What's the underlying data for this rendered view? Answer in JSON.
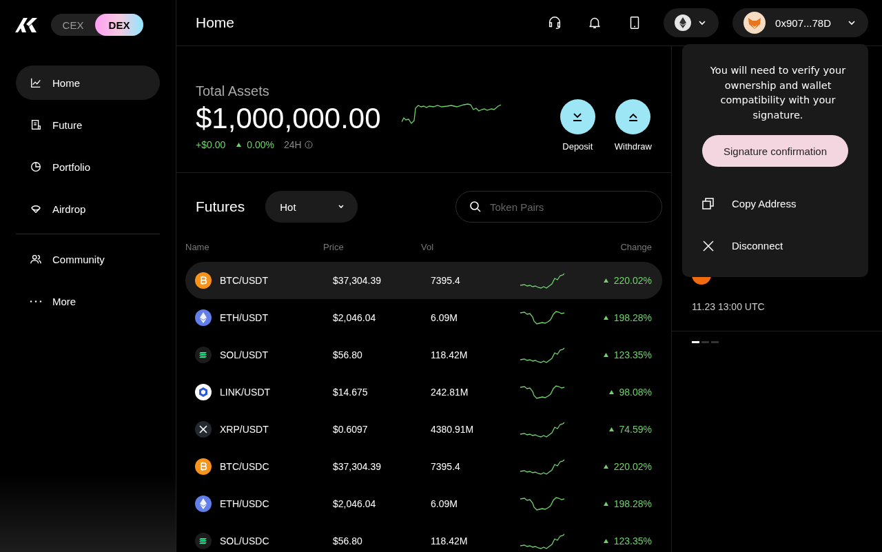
{
  "sidebar": {
    "mode_toggle": [
      {
        "label": "CEX",
        "selected": false
      },
      {
        "label": "DEX",
        "selected": true
      }
    ],
    "items": [
      {
        "kind": "chart",
        "label": "Home",
        "selected": true
      },
      {
        "kind": "doc",
        "label": "Future",
        "selected": false
      },
      {
        "kind": "pie",
        "label": "Portfolio",
        "selected": false
      },
      {
        "kind": "parachute",
        "label": "Airdrop",
        "selected": false
      },
      {
        "kind": "divider"
      },
      {
        "kind": "people",
        "label": "Community",
        "selected": false
      },
      {
        "kind": "dots",
        "label": "More",
        "selected": false
      }
    ]
  },
  "header": {
    "title": "Home",
    "wallet_address": "0x907...78D"
  },
  "assets": {
    "label": "Total Assets",
    "value": "$1,000,000.00",
    "change": "+$0.00",
    "change_pct": "0.00%",
    "period": "24H",
    "actions": [
      {
        "kind": "down",
        "label": "Deposit"
      },
      {
        "kind": "up",
        "label": "Withdraw"
      }
    ]
  },
  "futures": {
    "title": "Futures",
    "filter": "Hot",
    "search": {
      "placeholder": "Token Pairs"
    },
    "columns": [
      "Name",
      "Price",
      "Vol",
      "Change"
    ],
    "rows": [
      {
        "kind": "btc",
        "pair": "BTC/USDT",
        "price": "$37,304.39",
        "vol": "7395.4",
        "change": "220.02%",
        "selected": true
      },
      {
        "kind": "eth",
        "pair": "ETH/USDT",
        "price": "$2,046.04",
        "vol": "6.09M",
        "change": "198.28%",
        "selected": false
      },
      {
        "kind": "sol",
        "pair": "SOL/USDT",
        "price": "$56.80",
        "vol": "118.42M",
        "change": "123.35%",
        "selected": false
      },
      {
        "kind": "link",
        "pair": "LINK/USDT",
        "price": "$14.675",
        "vol": "242.81M",
        "change": "98.08%",
        "selected": false
      },
      {
        "kind": "xrp",
        "pair": "XRP/USDT",
        "price": "$0.6097",
        "vol": "4380.91M",
        "change": "74.59%",
        "selected": false
      },
      {
        "kind": "btc",
        "pair": "BTC/USDC",
        "price": "$37,304.39",
        "vol": "7395.4",
        "change": "220.02%",
        "selected": false
      },
      {
        "kind": "eth",
        "pair": "ETH/USDC",
        "price": "$2,046.04",
        "vol": "6.09M",
        "change": "198.28%",
        "selected": false
      },
      {
        "kind": "sol",
        "pair": "SOL/USDC",
        "price": "$56.80",
        "vol": "118.42M",
        "change": "123.35%",
        "selected": false
      }
    ]
  },
  "banner": {
    "date": "11.23 13:00 UTC"
  },
  "wallet_menu": {
    "message": "You will need to verify your ownership and wallet compatibility with your signature.",
    "confirm": "Signature confirmation",
    "items": [
      {
        "kind": "copy",
        "label": "Copy Address"
      },
      {
        "kind": "close",
        "label": "Disconnect"
      }
    ]
  }
}
